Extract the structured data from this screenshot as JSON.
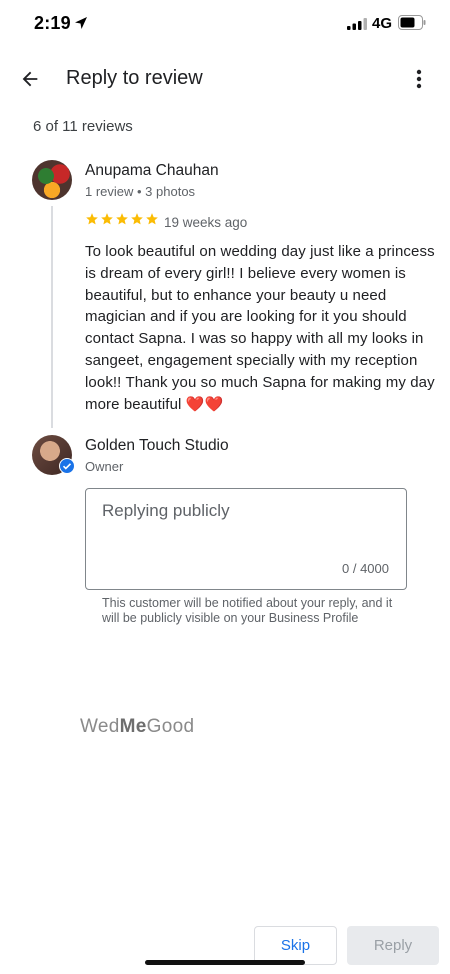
{
  "status_bar": {
    "time": "2:19",
    "network": "4G",
    "icons": [
      "location-arrow-icon",
      "signal-icon",
      "battery-icon"
    ]
  },
  "header": {
    "title": "Reply to review",
    "back_icon": "arrow-back-icon",
    "more_icon": "more-vert-icon"
  },
  "review_counter": "6 of 11 reviews",
  "review": {
    "reviewer_name": "Anupama Chauhan",
    "reviewer_meta": "1 review • 3 photos",
    "rating": 5,
    "rating_max": 5,
    "time_ago": "19 weeks ago",
    "text": "To look beautiful on wedding day just like a princess is dream of every girl!! I believe every women is beautiful, but to enhance your beauty u need magician and if you are looking for it you should contact Sapna. I was so happy with all my looks in sangeet, engagement specially with my reception look!! Thank you so much Sapna for making my day more beautiful",
    "text_emoji": "❤️❤️"
  },
  "owner": {
    "name": "Golden Touch Studio",
    "role": "Owner"
  },
  "reply": {
    "placeholder": "Replying publicly",
    "value": "",
    "char_count": "0 / 4000",
    "helper": "This customer will be notified about your reply, and it will be publicly visible on your Business Profile"
  },
  "watermark": {
    "part1": "Wed",
    "part2": "Me",
    "part3": "Good"
  },
  "actions": {
    "skip_label": "Skip",
    "reply_label": "Reply"
  },
  "colors": {
    "accent": "#1a73e8",
    "star": "#fbbc04",
    "verified": "#1a73e8",
    "disabled_bg": "#e8eaed"
  }
}
